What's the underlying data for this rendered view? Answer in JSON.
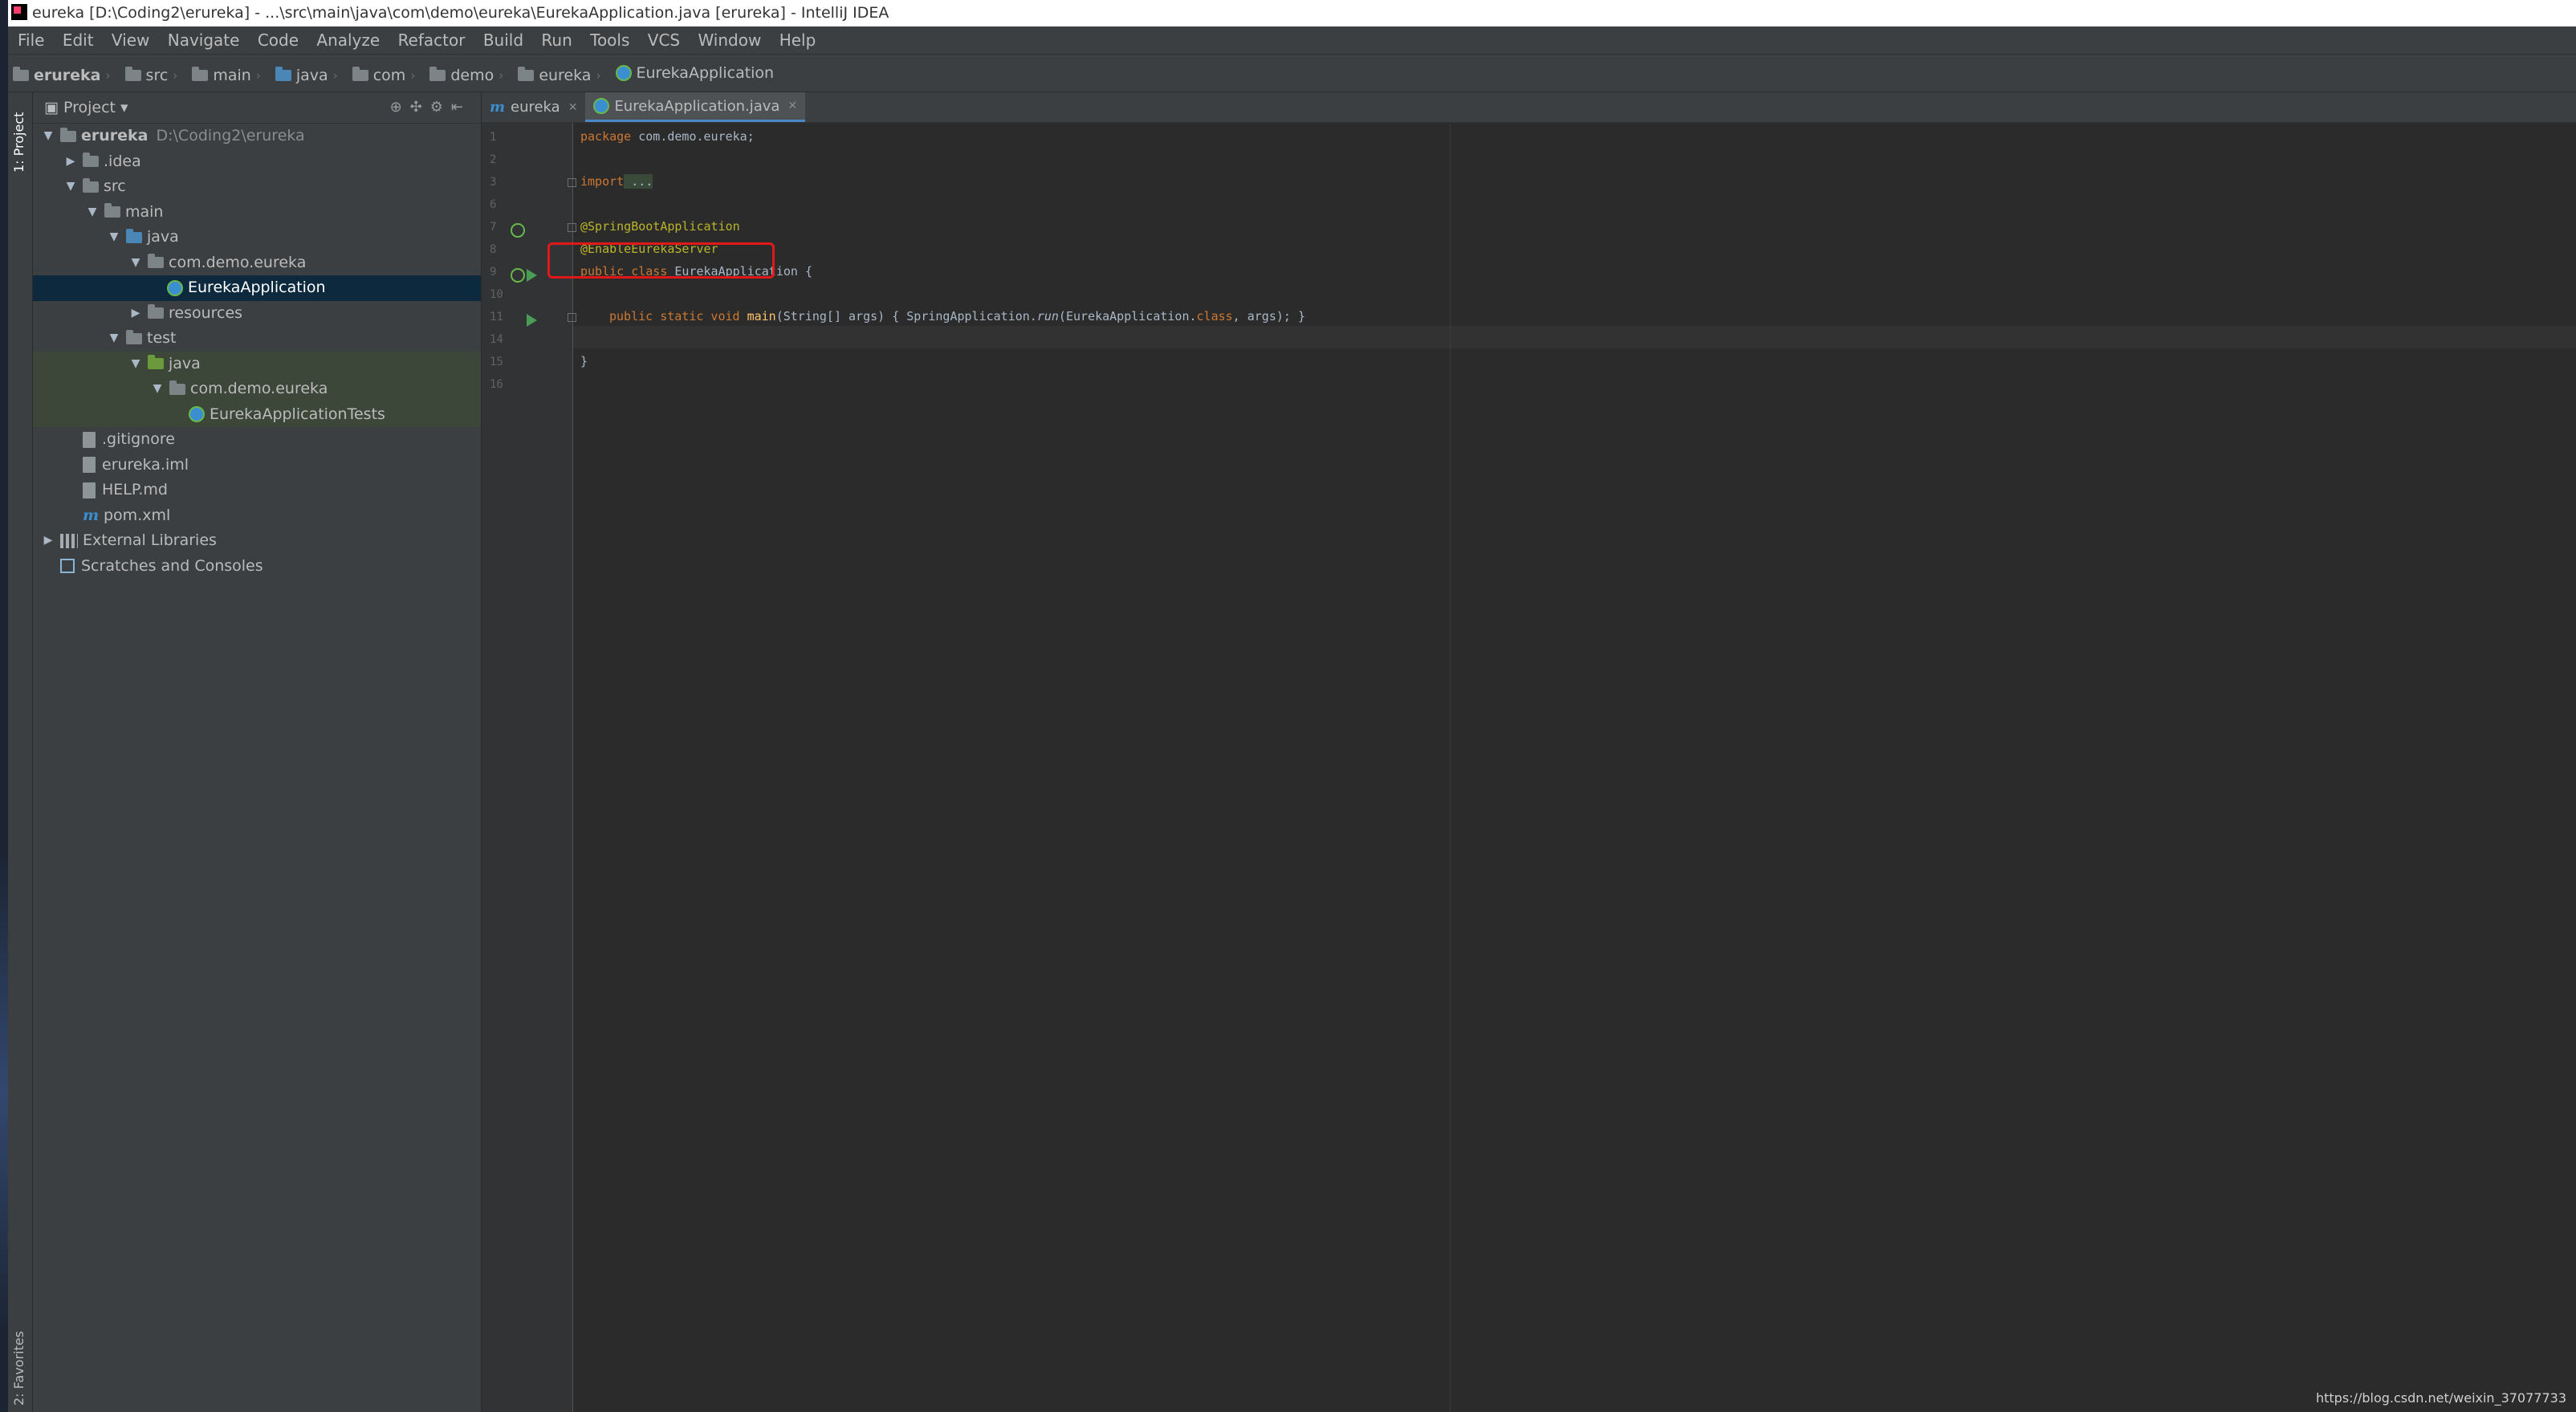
{
  "window": {
    "title": "eureka [D:\\Coding2\\erureka] - ...\\src\\main\\java\\com\\demo\\eureka\\EurekaApplication.java [erureka] - IntelliJ IDEA"
  },
  "menu": [
    "File",
    "Edit",
    "View",
    "Navigate",
    "Code",
    "Analyze",
    "Refactor",
    "Build",
    "Run",
    "Tools",
    "VCS",
    "Window",
    "Help"
  ],
  "breadcrumb": [
    "erureka",
    "src",
    "main",
    "java",
    "com",
    "demo",
    "eureka",
    "EurekaApplication"
  ],
  "sidebar_tabs": {
    "project": "1: Project",
    "favorites": "2: Favorites"
  },
  "project_panel": {
    "title": "Project",
    "tree": [
      {
        "label": "erureka",
        "path": "D:\\Coding2\\erureka"
      },
      {
        "label": ".idea"
      },
      {
        "label": "src"
      },
      {
        "label": "main"
      },
      {
        "label": "java"
      },
      {
        "label": "com.demo.eureka"
      },
      {
        "label": "EurekaApplication"
      },
      {
        "label": "resources"
      },
      {
        "label": "test"
      },
      {
        "label": "java"
      },
      {
        "label": "com.demo.eureka"
      },
      {
        "label": "EurekaApplicationTests"
      },
      {
        "label": ".gitignore"
      },
      {
        "label": "erureka.iml"
      },
      {
        "label": "HELP.md"
      },
      {
        "label": "pom.xml"
      },
      {
        "label": "External Libraries"
      },
      {
        "label": "Scratches and Consoles"
      }
    ]
  },
  "editor": {
    "tabs": [
      {
        "label": "eureka",
        "icon": "maven-m-icon"
      },
      {
        "label": "EurekaApplication.java",
        "icon": "spring-class-icon"
      }
    ],
    "line_numbers": [
      "1",
      "2",
      "3",
      "6",
      "7",
      "8",
      "9",
      "10",
      "11",
      "14",
      "15",
      "16"
    ],
    "code": {
      "l1_kw": "package",
      "l1_rest": " com.demo.eureka;",
      "l3_kw": "import",
      "l3_rest": " ...",
      "l7": "@SpringBootApplication",
      "l8": "@EnableEurekaServer",
      "l9_kw": "public class",
      "l9_name": " EurekaApplication",
      "l9_rest": " {",
      "l11_kw": "public static void",
      "l11_fn": " main",
      "l11_a": "(String[] args) { SpringApplication.",
      "l11_run": "run",
      "l11_b": "(EurekaApplication.",
      "l11_cls": "class",
      "l11_c": ", args); }",
      "l15": "}"
    }
  },
  "watermark": "https://blog.csdn.net/weixin_37077733",
  "colors": {
    "keyword": "#cc7832",
    "annotation": "#bbb529",
    "highlight_box": "#e01818",
    "selection": "#0d293e"
  }
}
